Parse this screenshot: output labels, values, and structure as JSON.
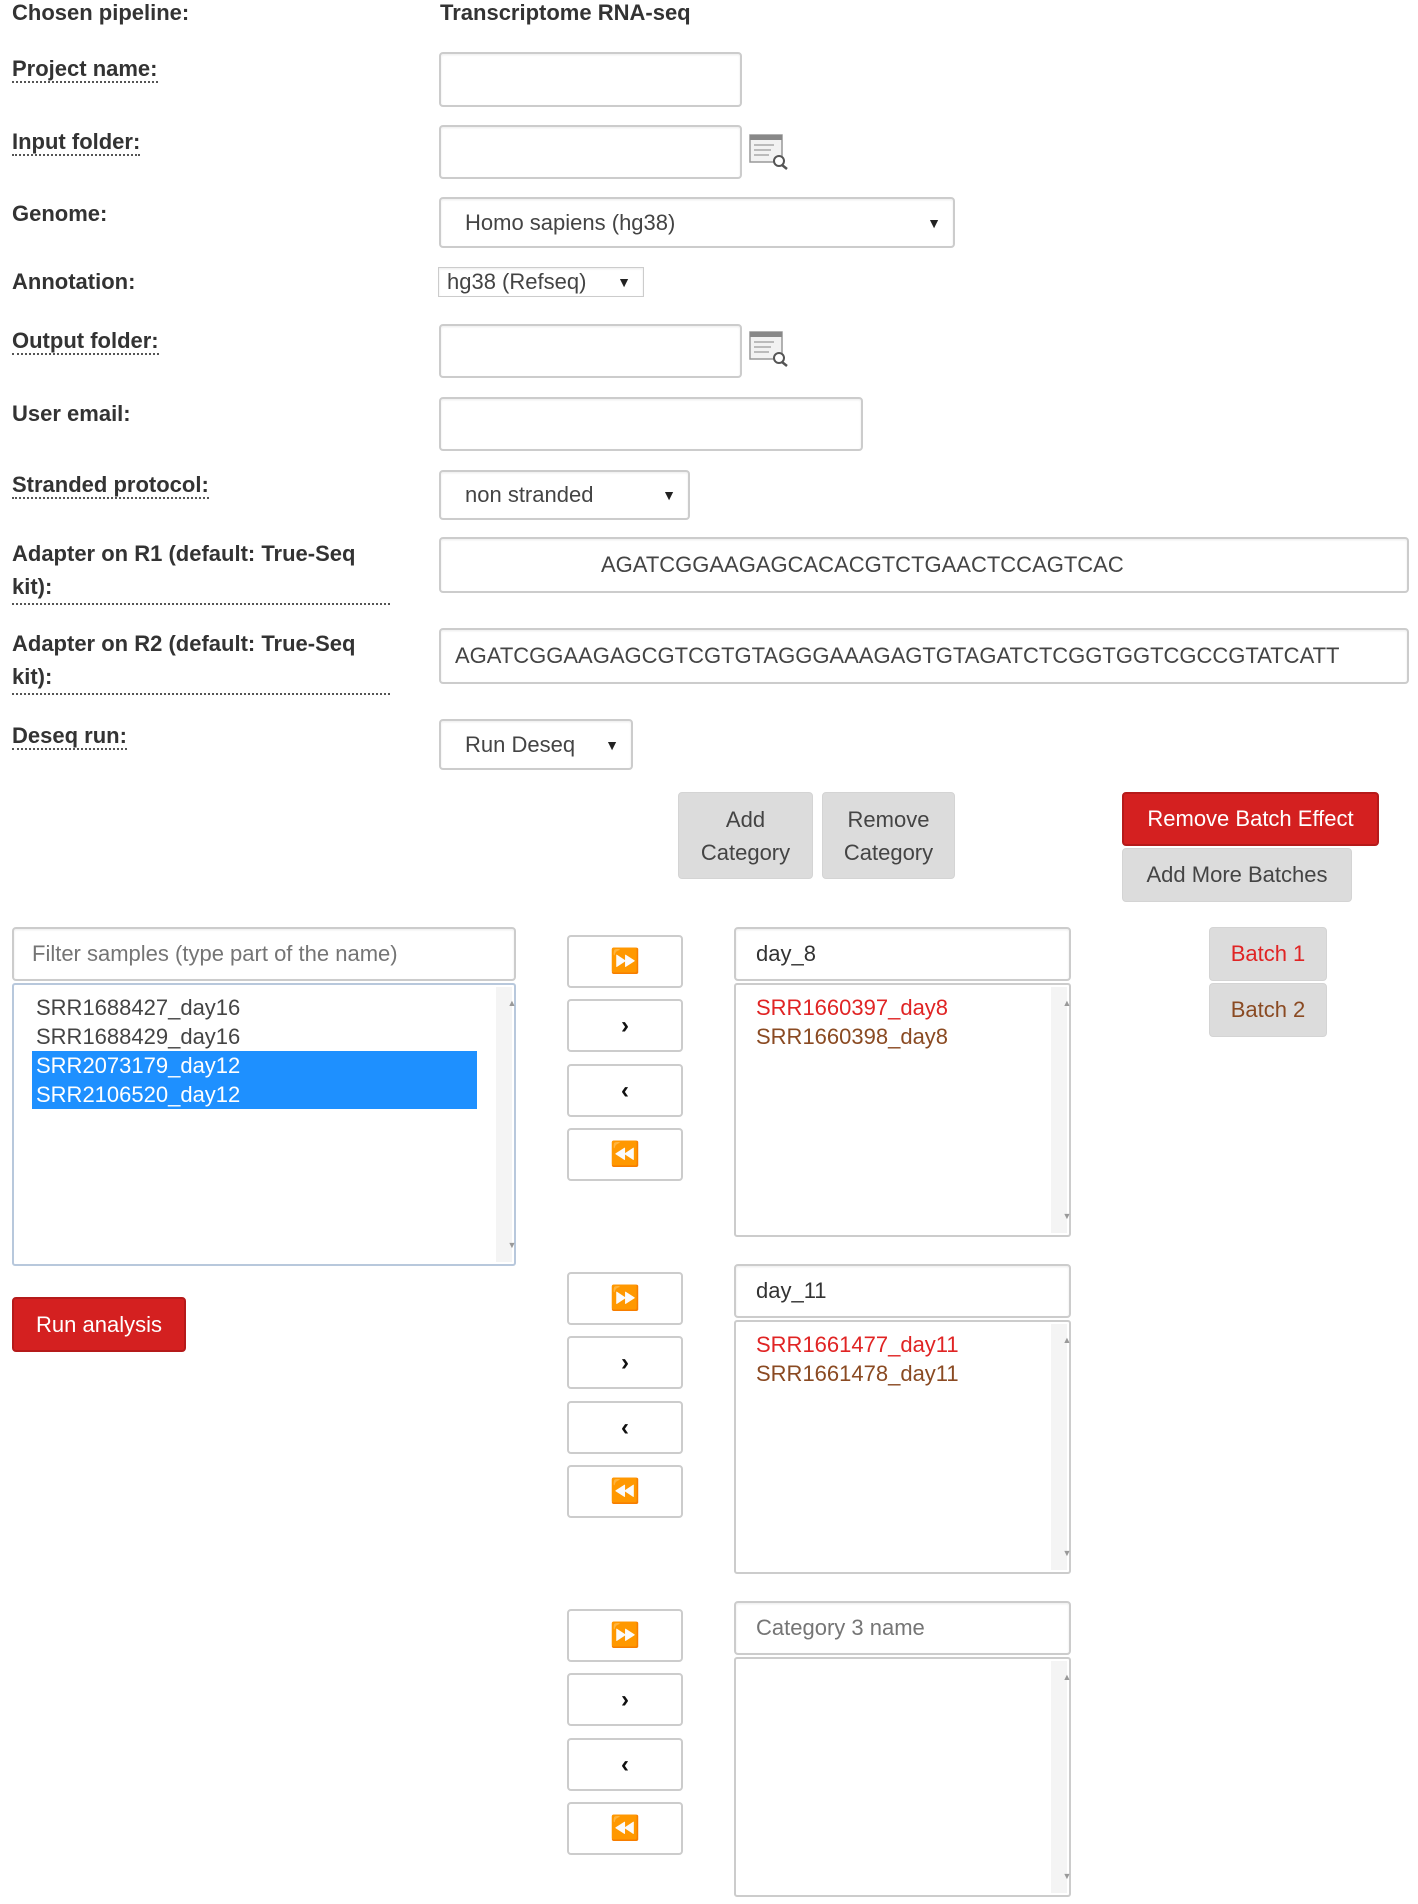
{
  "form": {
    "pipeline_label": "Chosen pipeline:",
    "pipeline_value": "Transcriptome RNA-seq",
    "project_name_label": "Project name:",
    "project_name_value": "",
    "input_folder_label": "Input folder:",
    "input_folder_value": "",
    "genome_label": "Genome:",
    "genome_value": "Homo sapiens (hg38)",
    "annotation_label": "Annotation:",
    "annotation_value": "hg38 (Refseq)",
    "output_folder_label": "Output folder:",
    "output_folder_value": "",
    "email_label": "User email:",
    "email_value": "",
    "stranded_label": "Stranded protocol:",
    "stranded_value": "non stranded",
    "adapter_r1_label_1": "Adapter on R1 (default: True-Seq",
    "adapter_r1_label_2": "kit):",
    "adapter_r1_value": "AGATCGGAAGAGCACACGTCTGAACTCCAGTCAC",
    "adapter_r2_label_1": "Adapter on R2 (default: True-Seq",
    "adapter_r2_label_2": "kit):",
    "adapter_r2_value": "AGATCGGAAGAGCGTCGTGTAGGGAAAGAGTGTAGATCTCGGTGGTCGCCGTATCATT",
    "deseq_label": "Deseq run:",
    "deseq_value": "Run Deseq"
  },
  "buttons": {
    "add_category_1": "Add",
    "add_category_2": "Category",
    "remove_category_1": "Remove",
    "remove_category_2": "Category",
    "remove_batch_effect": "Remove Batch Effect",
    "add_more_batches": "Add More Batches",
    "run_analysis": "Run analysis",
    "move_all_right": "⏩",
    "move_right": "›",
    "move_left": "‹",
    "move_all_left": "⏪"
  },
  "batches": [
    {
      "label": "Batch 1",
      "color": "#e02424"
    },
    {
      "label": "Batch 2",
      "color": "#8a4a22"
    }
  ],
  "samples": {
    "filter_placeholder": "Filter samples (type part of the name)",
    "items": [
      {
        "name": "SRR1688427_day16",
        "selected": false
      },
      {
        "name": "SRR1688429_day16",
        "selected": false
      },
      {
        "name": "SRR2073179_day12",
        "selected": true
      },
      {
        "name": "SRR2106520_day12",
        "selected": true
      }
    ]
  },
  "categories": [
    {
      "name": "day_8",
      "placeholder": "",
      "items": [
        {
          "name": "SRR1660397_day8",
          "batch": 1
        },
        {
          "name": "SRR1660398_day8",
          "batch": 2
        }
      ]
    },
    {
      "name": "day_11",
      "placeholder": "",
      "items": [
        {
          "name": "SRR1661477_day11",
          "batch": 1
        },
        {
          "name": "SRR1661478_day11",
          "batch": 2
        }
      ]
    },
    {
      "name": "",
      "placeholder": "Category 3 name",
      "items": []
    }
  ],
  "colors": {
    "accent_red": "#d42020",
    "selection_blue": "#1e90ff"
  }
}
